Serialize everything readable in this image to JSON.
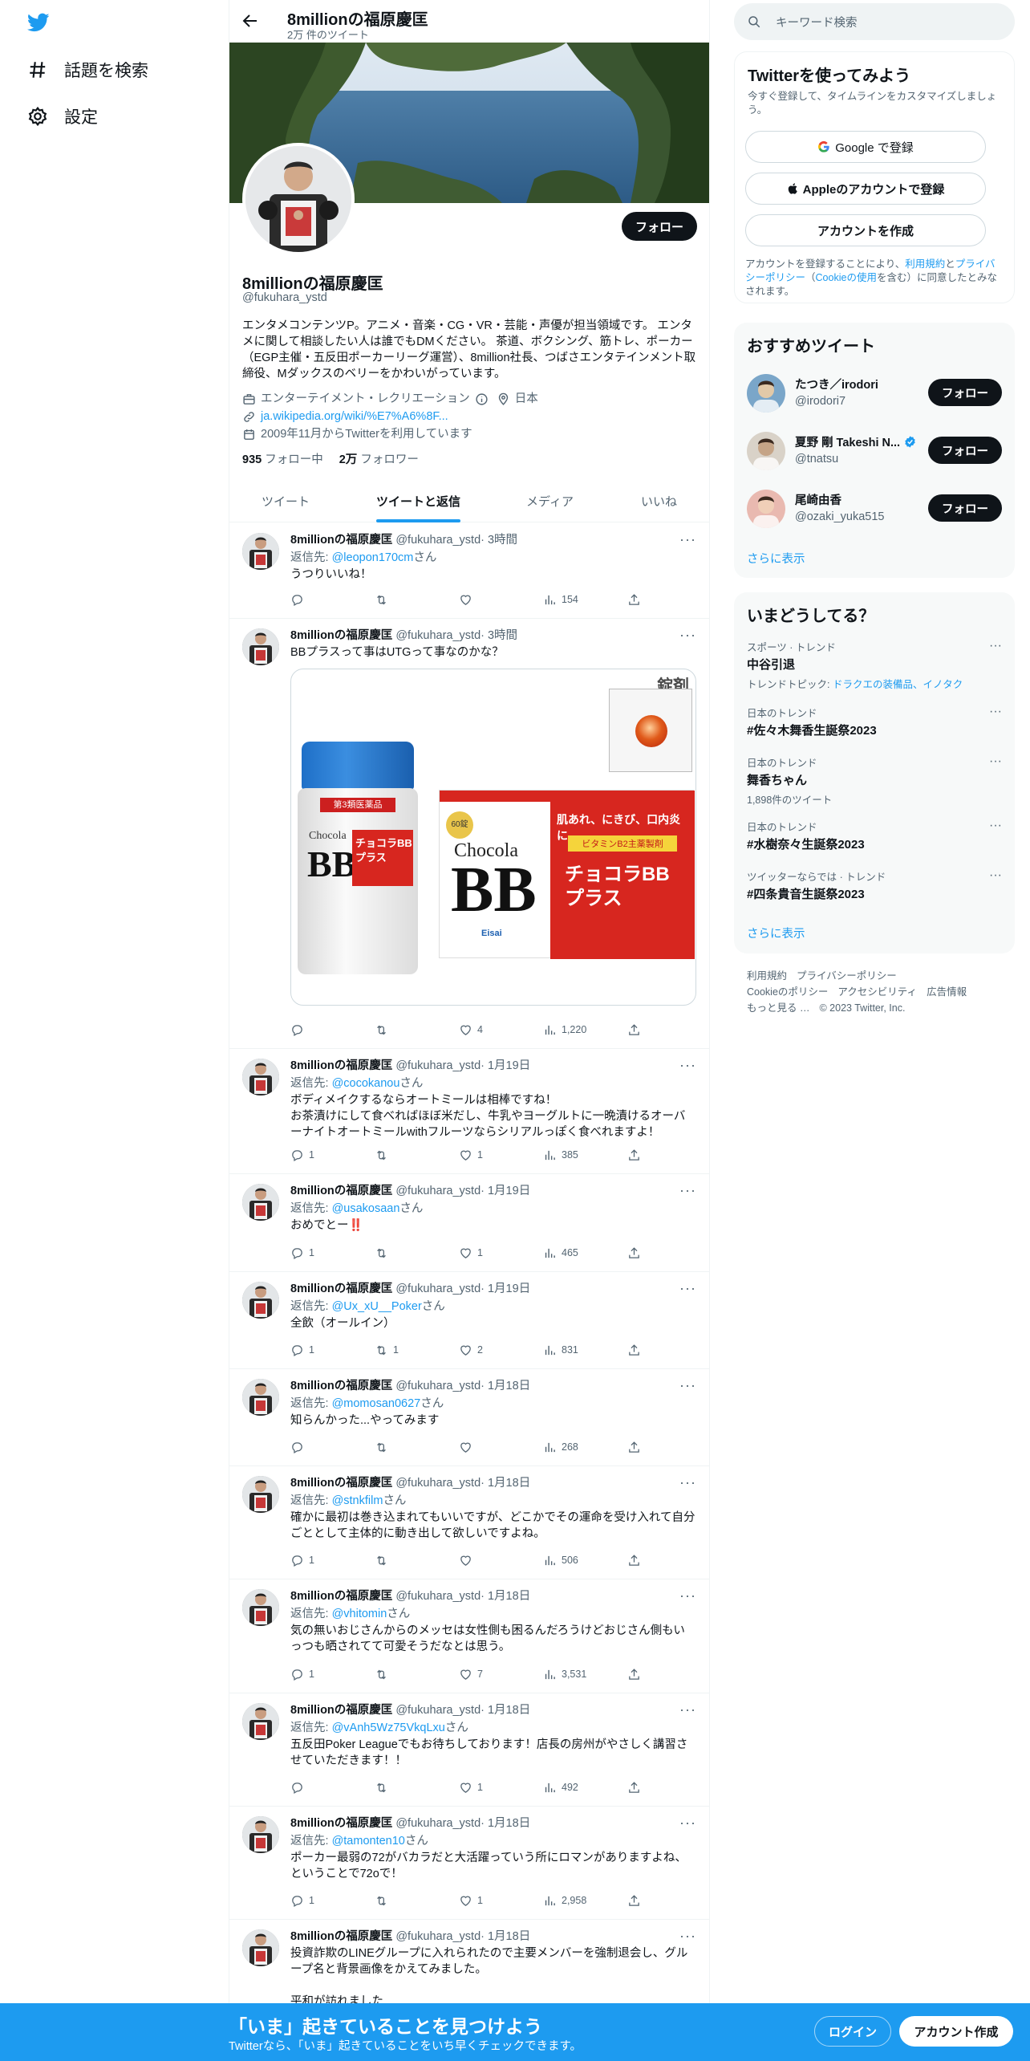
{
  "nav": {
    "explore": "話題を検索",
    "settings": "設定"
  },
  "header": {
    "title": "8millionの福原慶匡",
    "subtitle": "2万 件のツイート"
  },
  "profile": {
    "name": "8millionの福原慶匡",
    "handle": "@fukuhara_ystd",
    "follow_label": "フォロー",
    "bio": "エンタメコンテンツP。アニメ・音楽・CG・VR・芸能・声優が担当領域です。 エンタメに関して相談したい人は誰でもDMください。 茶道、ボクシング、筋トレ、ポーカー（EGP主催・五反田ポーカーリーグ運営）、8million社長、つばさエンタテインメント取締役、Mダックスのベリーをかわいがっています。",
    "category": "エンターテイメント・レクリエーション",
    "location": "日本",
    "url": "ja.wikipedia.org/wiki/%E7%A6%8F...",
    "joined": "2009年11月からTwitterを利用しています",
    "following_count": "935",
    "following_label": "フォロー中",
    "followers_count": "2万",
    "followers_label": "フォロワー"
  },
  "tabs": [
    "ツイート",
    "ツイートと返信",
    "メディア",
    "いいね"
  ],
  "reply_prefix": "返信先: ",
  "reply_suffix": "さん",
  "tweets": [
    {
      "name": "8millionの福原慶匡",
      "handle": "@fukuhara_ystd",
      "time": "· 3時間",
      "reply_to": "@leopon170cm",
      "text": "うつりいいね！",
      "replies": "",
      "retweets": "",
      "likes": "",
      "views": "154"
    },
    {
      "name": "8millionの福原慶匡",
      "handle": "@fukuhara_ystd",
      "time": "· 3時間",
      "reply_to": "",
      "text": "BBプラスって事はUTGって事なのかな？",
      "replies": "",
      "retweets": "",
      "likes": "4",
      "views": "1,220",
      "media": {
        "stamp": "錠剤",
        "sticker": "第3類医薬品",
        "small_brand": "Chocola",
        "small_bb": "BB",
        "small_jp": "チョコラBB\nプラス",
        "box_top": "肌あれ、にきび、口内炎に",
        "box_vit": "ビタミンB2主薬製剤",
        "box_brand": "Chocola",
        "box_bb": "BB",
        "box_jp": "チョコラBB\nプラス",
        "box_60": "60錠",
        "box_maker": "Eisai"
      }
    },
    {
      "name": "8millionの福原慶匡",
      "handle": "@fukuhara_ystd",
      "time": "· 1月19日",
      "reply_to": "@cocokanou",
      "text": "ボディメイクするならオートミールは相棒ですね！\nお茶漬けにして食べればほぼ米だし、牛乳やヨーグルトに一晩漬けるオーバーナイトオートミールwithフルーツならシリアルっぽく食べれますよ！",
      "replies": "1",
      "retweets": "",
      "likes": "1",
      "views": "385"
    },
    {
      "name": "8millionの福原慶匡",
      "handle": "@fukuhara_ystd",
      "time": "· 1月19日",
      "reply_to": "@usakosaan",
      "text": "おめでとー‼️",
      "replies": "1",
      "retweets": "",
      "likes": "1",
      "views": "465"
    },
    {
      "name": "8millionの福原慶匡",
      "handle": "@fukuhara_ystd",
      "time": "· 1月19日",
      "reply_to": "@Ux_xU__Poker",
      "text": "全飲（オールイン）",
      "replies": "1",
      "retweets": "1",
      "likes": "2",
      "views": "831"
    },
    {
      "name": "8millionの福原慶匡",
      "handle": "@fukuhara_ystd",
      "time": "· 1月18日",
      "reply_to": "@momosan0627",
      "text": "知らんかった...やってみます",
      "replies": "",
      "retweets": "",
      "likes": "",
      "views": "268"
    },
    {
      "name": "8millionの福原慶匡",
      "handle": "@fukuhara_ystd",
      "time": "· 1月18日",
      "reply_to": "@stnkfilm",
      "text": "確かに最初は巻き込まれてもいいですが、どこかでその運命を受け入れて自分ごととして主体的に動き出して欲しいですよね。",
      "replies": "1",
      "retweets": "",
      "likes": "",
      "views": "506"
    },
    {
      "name": "8millionの福原慶匡",
      "handle": "@fukuhara_ystd",
      "time": "· 1月18日",
      "reply_to": "@vhitomin",
      "text": "気の無いおじさんからのメッセは女性側も困るんだろうけどおじさん側もいっつも晒されてて可愛そうだなとは思う。",
      "replies": "1",
      "retweets": "",
      "likes": "7",
      "views": "3,531"
    },
    {
      "name": "8millionの福原慶匡",
      "handle": "@fukuhara_ystd",
      "time": "· 1月18日",
      "reply_to": "@vAnh5Wz75VkqLxu",
      "text": "五反田Poker Leagueでもお待ちしております！店長の房州がやさしく講習させていただきます！！",
      "replies": "",
      "retweets": "",
      "likes": "1",
      "views": "492"
    },
    {
      "name": "8millionの福原慶匡",
      "handle": "@fukuhara_ystd",
      "time": "· 1月18日",
      "reply_to": "@tamonten10",
      "text": "ポーカー最弱の72がバカラだと大活躍っていう所にロマンがありますよね、ということで72oで！",
      "replies": "1",
      "retweets": "",
      "likes": "1",
      "views": "2,958"
    },
    {
      "name": "8millionの福原慶匡",
      "handle": "@fukuhara_ystd",
      "time": "· 1月18日",
      "reply_to": "",
      "text": "投資詐欺のLINEグループに入れられたので主要メンバーを強制退会し、グループ名と背景画像をかえてみました。\n\n平和が訪れました",
      "replies": "",
      "retweets": "",
      "likes": "",
      "views": ""
    }
  ],
  "search": {
    "placeholder": "キーワード検索"
  },
  "signup": {
    "title": "Twitterを使ってみよう",
    "desc": "今すぐ登録して、タイムラインをカスタマイズしましょう。",
    "google": "Google で登録",
    "apple": "Appleのアカウントで登録",
    "create": "アカウントを作成",
    "legal_1": "アカウントを登録することにより、",
    "legal_terms": "利用規約",
    "legal_2": "と",
    "legal_privacy": "プライバシーポリシー",
    "legal_3": "（",
    "legal_cookie": "Cookieの使用",
    "legal_4": "を含む）に同意したとみなされます。"
  },
  "recommend": {
    "title": "おすすめツイート",
    "users": [
      {
        "name": "たつき／irodori",
        "handle": "@irodori7",
        "verified": false
      },
      {
        "name": "夏野 剛 Takeshi N...",
        "handle": "@tnatsu",
        "verified": true
      },
      {
        "name": "尾崎由香",
        "handle": "@ozaki_yuka515",
        "verified": false
      }
    ],
    "follow_label": "フォロー",
    "show_more": "さらに表示"
  },
  "trends": {
    "title": "いまどうしてる？",
    "items": [
      {
        "category": "スポーツ · トレンド",
        "name": "中谷引退",
        "sub_prefix": "トレンドトピック: ",
        "sub_links": "ドラクエの装備品、イノタク",
        "sub": ""
      },
      {
        "category": "日本のトレンド",
        "name": "#佐々木舞香生誕祭2023",
        "sub_prefix": "",
        "sub_links": "",
        "sub": ""
      },
      {
        "category": "日本のトレンド",
        "name": "舞香ちゃん",
        "sub_prefix": "",
        "sub_links": "",
        "sub": "1,898件のツイート"
      },
      {
        "category": "日本のトレンド",
        "name": "#水樹奈々生誕祭2023",
        "sub_prefix": "",
        "sub_links": "",
        "sub": ""
      },
      {
        "category": "ツイッターならでは · トレンド",
        "name": "#四条貴音生誕祭2023",
        "sub_prefix": "",
        "sub_links": "",
        "sub": ""
      }
    ],
    "show_more": "さらに表示"
  },
  "footer": {
    "links_row1": [
      "利用規約",
      "プライバシーポリシー"
    ],
    "links_row2": [
      "Cookieのポリシー",
      "アクセシビリティ",
      "広告情報"
    ],
    "more": "もっと見る …",
    "copyright": "© 2023 Twitter, Inc."
  },
  "bottom": {
    "title": "「いま」起きていることを見つけよう",
    "subtitle": "Twitterなら、「いま」起きていることをいち早くチェックできます。",
    "login": "ログイン",
    "signup": "アカウント作成"
  },
  "colors": {
    "accent": "#1d9bf0",
    "text": "#0f1419",
    "muted": "#536471"
  }
}
